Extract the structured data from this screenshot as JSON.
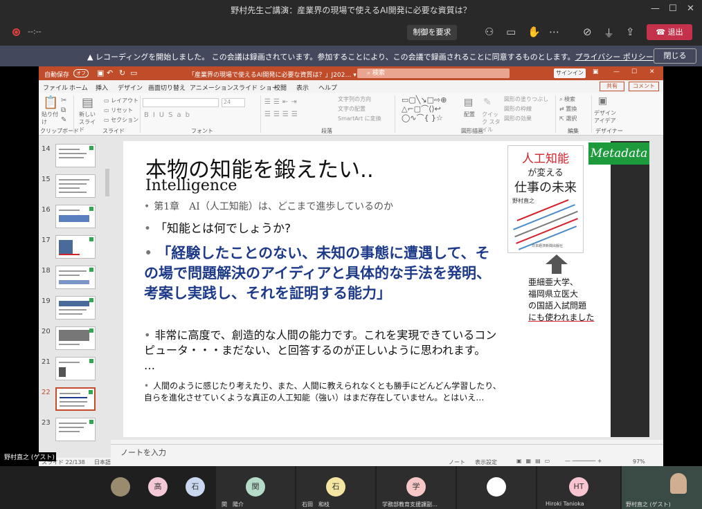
{
  "window": {
    "title": "野村先生ご講演：産業界の現場で使えるAI開発に必要な資質は？",
    "min": "—",
    "max": "☐",
    "close": "✕"
  },
  "call": {
    "timer": "--:--",
    "control_btn": "制御を要求",
    "leave_btn": "退出",
    "leave_icon": "☎"
  },
  "banner": {
    "icon": "▲",
    "strong": "レコーディングを開始しました。",
    "text": " この会議は録画されています。参加することにより、この会議で録画されることに同意するものとします。",
    "link": "プライバシー ポリシー",
    "close": "閉じる"
  },
  "ppt": {
    "autosave": "自動保存",
    "autosave_state": "オフ",
    "doc_title": "「産業界の現場で使えるAI開発に必要な資質は？」J202… ▾",
    "search": "検索",
    "signin": "サインイン",
    "tabs": [
      "ファイル",
      "ホーム",
      "挿入",
      "デザイン",
      "画面切り替え",
      "アニメーション",
      "スライド ショー",
      "校閲",
      "表示",
      "ヘルプ"
    ],
    "share": "共有",
    "comment": "コメント",
    "ribbon": {
      "paste": "貼り付け",
      "new_slide": "新しい スライド",
      "layout": "レイアウト",
      "reset": "リセット",
      "section": "セクション",
      "size": "24",
      "text_dir": "文字列の方向",
      "align": "文字の配置",
      "smartart": "SmartArt に変換",
      "arrange": "配置",
      "quick_style": "クイック スタイル",
      "fill": "図形の塗りつぶし",
      "outline": "図形の枠線",
      "effect": "図形の効果",
      "find": "検索",
      "replace": "置換",
      "select": "選択",
      "designer": "デザイン アイデア",
      "groups": [
        "クリップボード",
        "スライド",
        "フォント",
        "段落",
        "図形描画",
        "編集",
        "デザイナー"
      ]
    },
    "thumbs": [
      "14",
      "15",
      "16",
      "17",
      "18",
      "19",
      "20",
      "21",
      "22",
      "23"
    ],
    "slide": {
      "title": "本物の知能を鍛えたい..",
      "subtitle": "Intelligence",
      "b1": "第1章　AI（人工知能）は、どこまで進歩しているのか",
      "b2": "「知能とは何でしょうか?",
      "quote": "「経験したことのない、未知の事態に遭遇して、その場で問題解決のアイディアと具体的な手法を発明、考案し実践し、それを証明する能力」",
      "para": "非常に高度で、創造的な人間の能力です。これを実現できているコンピュータ・・・まだない、と回答するのが正しいように思われます。 …",
      "small": "人間のように感じたり考えたり、また、人間に教えられなくとも勝手にどんどん学習したり、自らを進化させていくような真正の人工知能（強い）はまだ存在していません。とはいえ…",
      "book_t1": "人工知能",
      "book_t2": "が変える",
      "book_t3": "仕事の未来",
      "book_author": "野村直之",
      "book_pub": "日本経済新聞出版社",
      "metadata": "Metadata",
      "note1": "亜細亜大学、",
      "note2": "福岡県立医大",
      "note3": "の国語入試問題",
      "note4": "にも使われました"
    },
    "notes": "ノートを入力",
    "status_slide": "スライド 22/138",
    "status_lang": "日本語",
    "status_notes": "ノート",
    "status_display": "表示設定",
    "zoom": "97%"
  },
  "participants": {
    "guest_label": "野村直之 (ゲスト)",
    "tiles": [
      {
        "label": "関　陽介",
        "initial": "関",
        "color": "#b5dcc9"
      },
      {
        "label": "石田　和枝",
        "initial": "石",
        "color": "#f4e5a1"
      },
      {
        "label": "学務部教育支援課副…",
        "initial": "学",
        "color": "#f7c7c7"
      },
      {
        "label": "",
        "initial": "",
        "color": "#ffffff"
      },
      {
        "label": "Hiroki Tanioka",
        "initial": "HT",
        "color": "#f7c4d0"
      },
      {
        "label": "野村直之 (ゲスト)",
        "initial": "",
        "color": "#3a4a44"
      }
    ],
    "small": [
      {
        "initial": "",
        "color": "#9a8a6e"
      },
      {
        "initial": "高",
        "color": "#f5c8d8"
      },
      {
        "initial": "石",
        "color": "#c9d8ee"
      }
    ]
  }
}
